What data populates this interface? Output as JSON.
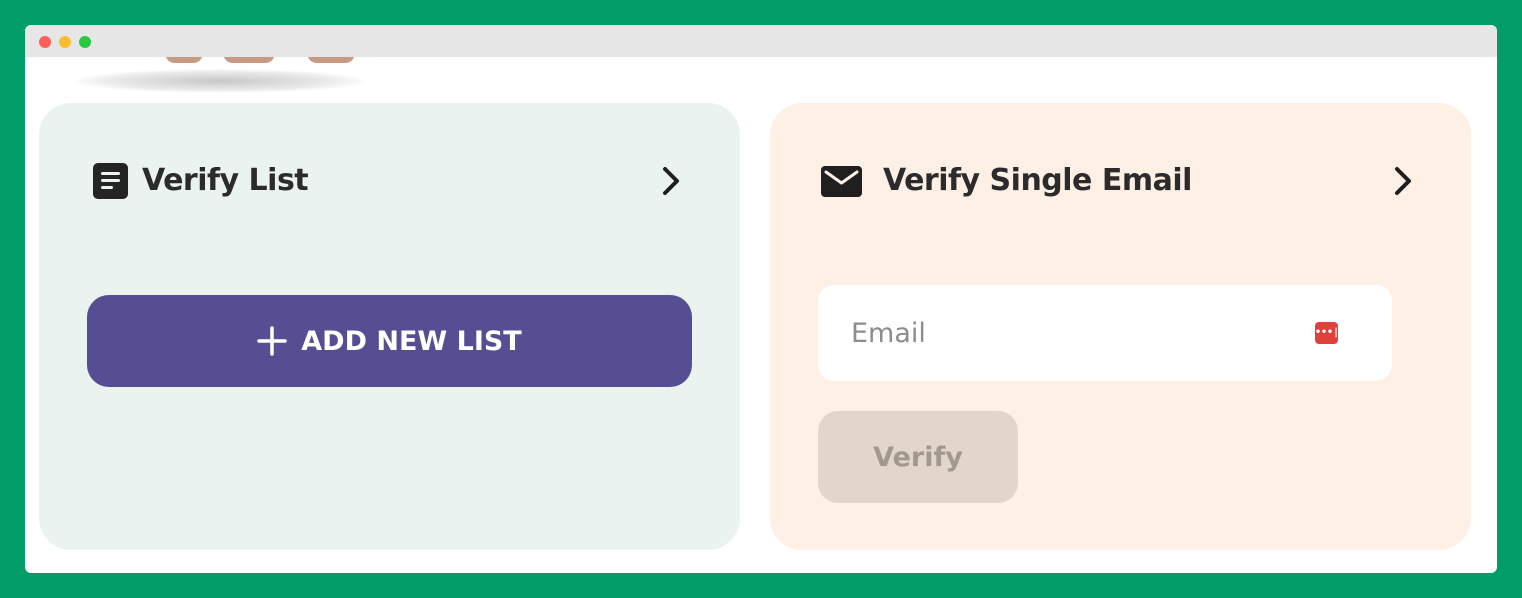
{
  "window": {
    "controls": [
      "close",
      "minimize",
      "maximize"
    ]
  },
  "verify_list": {
    "title": "Verify List",
    "icon": "list-document-icon",
    "add_button_label": "ADD NEW LIST",
    "add_button_color": "#564e93",
    "background": "#eaf3f0"
  },
  "verify_single": {
    "title": "Verify Single Email",
    "icon": "envelope-icon",
    "email_placeholder": "Email",
    "email_value": "",
    "password_manager_icon": "password-manager-icon",
    "verify_button_label": "Verify",
    "verify_button_state": "disabled",
    "background": "#fff0e6"
  },
  "colors": {
    "page_background": "#009d68",
    "accent": "#564e93"
  }
}
